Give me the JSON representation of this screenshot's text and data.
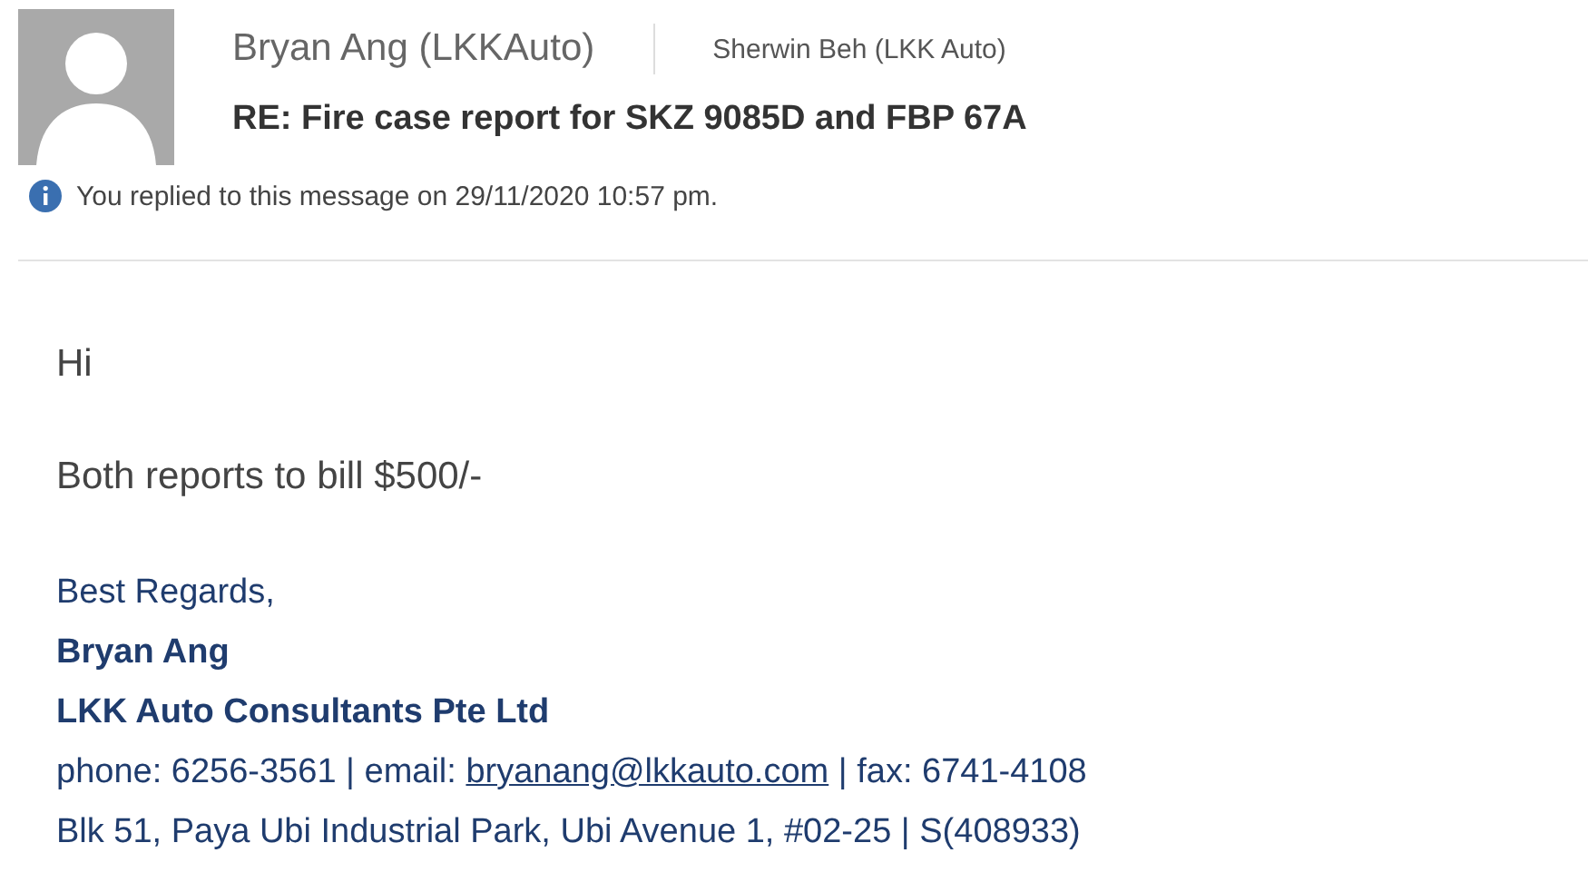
{
  "header": {
    "sender": "Bryan Ang (LKKAuto)",
    "recipient": "Sherwin Beh (LKK Auto)",
    "subject": "RE: Fire case report for SKZ 9085D and FBP 67A",
    "info": "You replied to this message on 29/11/2020 10:57 pm."
  },
  "body": {
    "paragraphs": [
      "Hi",
      "Both reports to bill $500/-"
    ]
  },
  "signature": {
    "closing": "Best Regards,",
    "name": "Bryan Ang",
    "company": "LKK Auto Consultants Pte Ltd",
    "contact": [
      {
        "kind": "text",
        "text": "phone: 6256-3561 | email: "
      },
      {
        "kind": "link",
        "text": "bryanang@lkkauto.com"
      },
      {
        "kind": "text",
        "text": " | fax: 6741-4108"
      }
    ],
    "address": "Blk 51, Paya Ubi Industrial Park, Ubi Avenue 1, #02-25 | S(408933)"
  }
}
